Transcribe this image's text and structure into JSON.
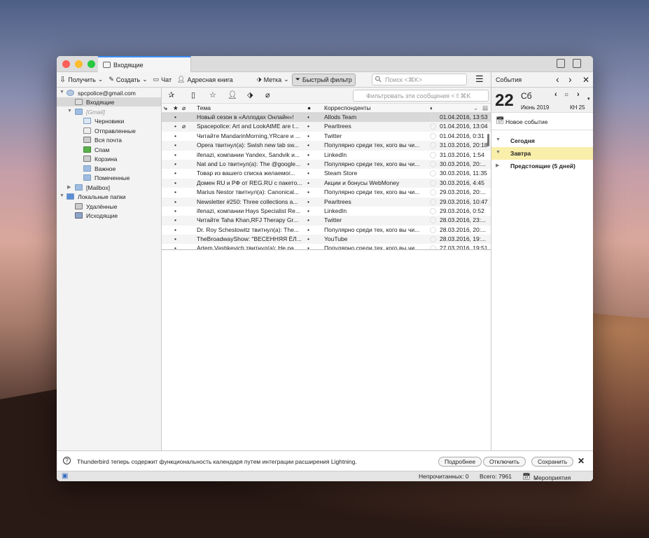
{
  "window": {
    "tab_title": "Входящие"
  },
  "toolbar": {
    "get": "Получить",
    "write": "Создать",
    "chat": "Чат",
    "addressbook": "Адресная книга",
    "tag": "Метка",
    "quickfilter": "Быстрый фильтр",
    "search_placeholder": "Поиск <⌘K>"
  },
  "folders": {
    "account": "spcpolice@gmail.com",
    "inbox": "Входящие",
    "gmail": "[Gmail]",
    "drafts": "Черновики",
    "sent": "Отправленные",
    "all": "Вся почта",
    "spam": "Спам",
    "trash": "Корзина",
    "important": "Важное",
    "starred": "Помеченные",
    "mailbox": "[Mailbox]",
    "local": "Локальные папки",
    "deleted": "Удалённые",
    "outbox": "Исходящие"
  },
  "quickfilter": {
    "placeholder": "Фильтровать эти сообщения <⇧⌘K"
  },
  "columns": {
    "subject": "Тема",
    "dot": "●",
    "correspondents": "Корреспонденты"
  },
  "messages": [
    {
      "subject": "Новый сезон в «Аллодах Онлайн»!",
      "from": "Allods Team",
      "date": "01.04.2016, 13:53",
      "attach": false
    },
    {
      "subject": "Spacepolice: Art and LookAtME are t...",
      "from": "Pearltrees",
      "date": "01.04.2016, 13:04",
      "attach": true
    },
    {
      "subject": "Читайте MandarinMorning,YRcare и ...",
      "from": "Twitter",
      "date": "01.04.2016, 0:31",
      "attach": false
    },
    {
      "subject": "Opera твитнул(а): Swish new tab sw...",
      "from": "Популярно среди тех, кого вы чи...",
      "date": "31.03.2016, 20:18",
      "attach": false
    },
    {
      "subject": "ifenazi, компании Yandex, Sandvik и...",
      "from": "LinkedIn",
      "date": "31.03.2016, 1:54",
      "attach": false
    },
    {
      "subject": "Nat and Lo твитнул(а): The @google...",
      "from": "Популярно среди тех, кого вы чи...",
      "date": "30.03.2016, 20:...",
      "attach": false
    },
    {
      "subject": "Товар из вашего списка желаемог...",
      "from": "Steam Store",
      "date": "30.03.2016, 11:35",
      "attach": false
    },
    {
      "subject": "Домен RU и РФ от REG.RU с пакето...",
      "from": "Акции и бонусы WebMoney",
      "date": "30.03.2016, 4:45",
      "attach": false
    },
    {
      "subject": "Marius Nestor твитнул(а): Canonical...",
      "from": "Популярно среди тех, кого вы чи...",
      "date": "29.03.2016, 20:...",
      "attach": false
    },
    {
      "subject": "Newsletter #250: Three collections a...",
      "from": "Pearltrees",
      "date": "29.03.2016, 10:47",
      "attach": false
    },
    {
      "subject": "ifenazi, компании Hays Specialist Re...",
      "from": "LinkedIn",
      "date": "29.03.2016, 0:52",
      "attach": false
    },
    {
      "subject": "Читайте Taha Khan,RFJ Therapy Gr...",
      "from": "Twitter",
      "date": "28.03.2016, 23:...",
      "attach": false
    },
    {
      "subject": "Dr. Roy Schestowitz твитнул(а): The...",
      "from": "Популярно среди тех, кого вы чи...",
      "date": "28.03.2016, 20:...",
      "attach": false
    },
    {
      "subject": "TheBroadwayShow: \"ВЕСЕННЯЯ ЁЛ...",
      "from": "YouTube",
      "date": "28.03.2016, 19:...",
      "attach": false
    },
    {
      "subject": "Artem Vashkevich твитнул(а): Не ра...",
      "from": "Популярно среди тех, кого вы чи...",
      "date": "27.03.2016, 19:51",
      "attach": false
    }
  ],
  "calendar": {
    "title": "События",
    "day": "22",
    "weekday": "Сб",
    "month_year": "Июнь 2019",
    "week": "КН 25",
    "new_event": "Новое событие",
    "today": "Сегодня",
    "tomorrow": "Завтра",
    "upcoming": "Предстоящие (5 дней)"
  },
  "notification": {
    "text": "Thunderbird теперь содержит функциональность календаря путем интеграции расширения Lightning.",
    "more": "Подробнее",
    "disable": "Отключить",
    "keep": "Сохранить"
  },
  "status": {
    "unread": "Непрочитанных: 0",
    "total": "Всего: 7961",
    "events": "Мероприятия"
  },
  "colors": {
    "accent": "#3d8ef5",
    "highlight": "#f9eeaa",
    "selected": "#d8d8d8"
  }
}
